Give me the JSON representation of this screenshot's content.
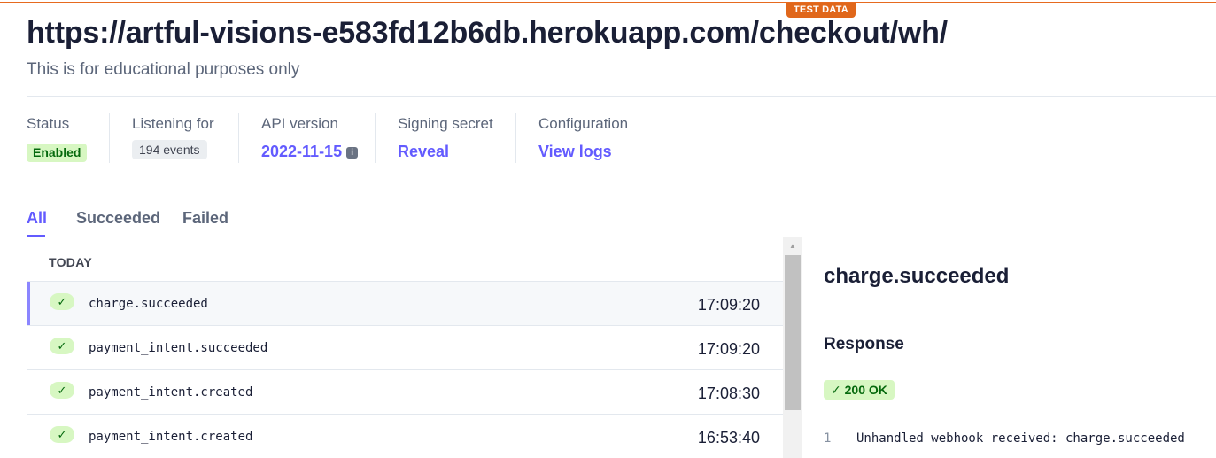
{
  "banner": {
    "test_data": "TEST DATA"
  },
  "header": {
    "title": "https://artful-visions-e583fd12b6db.herokuapp.com/checkout/wh/",
    "subtitle": "This is for educational purposes only"
  },
  "meta": {
    "status": {
      "label": "Status",
      "value": "Enabled"
    },
    "listening": {
      "label": "Listening for",
      "value": "194 events"
    },
    "api_version": {
      "label": "API version",
      "value": "2022-11-15",
      "info_icon": "info-icon"
    },
    "signing_secret": {
      "label": "Signing secret",
      "value": "Reveal"
    },
    "configuration": {
      "label": "Configuration",
      "value": "View logs"
    }
  },
  "tabs": [
    {
      "label": "All",
      "active": true
    },
    {
      "label": "Succeeded",
      "active": false
    },
    {
      "label": "Failed",
      "active": false
    }
  ],
  "events": {
    "group_label": "TODAY",
    "rows": [
      {
        "name": "charge.succeeded",
        "time": "17:09:20",
        "status_icon": "check-icon",
        "selected": true
      },
      {
        "name": "payment_intent.succeeded",
        "time": "17:09:20",
        "status_icon": "check-icon",
        "selected": false
      },
      {
        "name": "payment_intent.created",
        "time": "17:08:30",
        "status_icon": "check-icon",
        "selected": false
      },
      {
        "name": "payment_intent.created",
        "time": "16:53:40",
        "status_icon": "check-icon",
        "selected": false
      }
    ]
  },
  "detail": {
    "title": "charge.succeeded",
    "response_heading": "Response",
    "status": "200 OK",
    "code": [
      {
        "line": "1",
        "text": "Unhandled webhook received: charge.succeeded"
      }
    ]
  },
  "colors": {
    "accent": "#635bff",
    "success_bg": "#d7f7c2",
    "success_text": "#05690d",
    "test_badge": "#e0671b"
  }
}
